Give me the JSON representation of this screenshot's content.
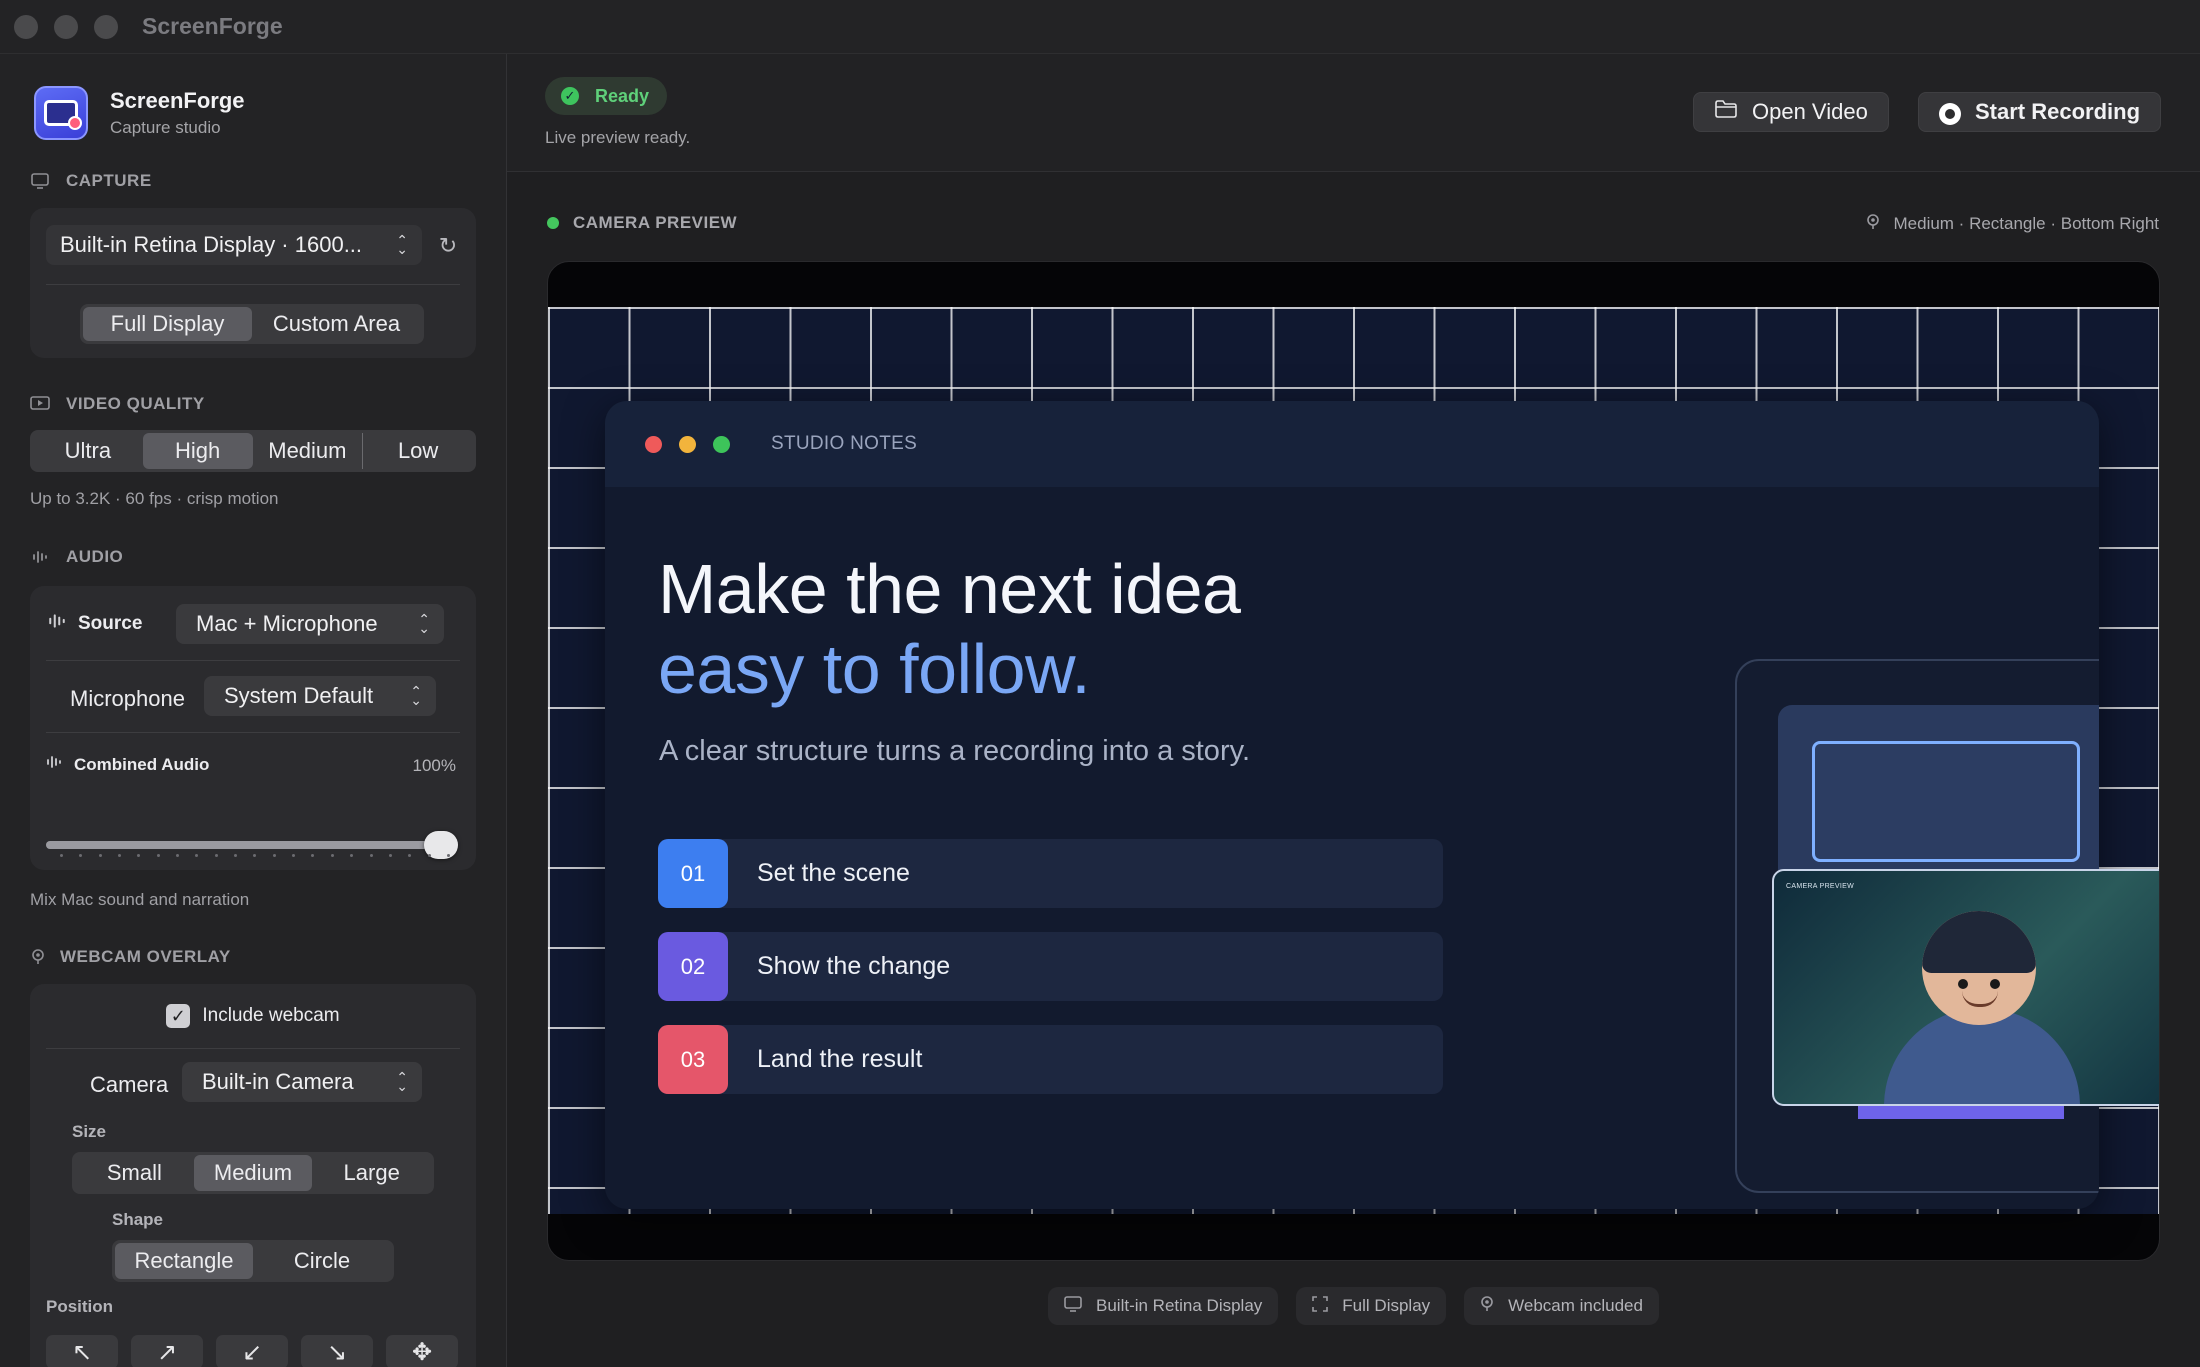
{
  "window": {
    "title": "ScreenForge"
  },
  "app": {
    "name": "ScreenForge",
    "subtitle": "Capture studio"
  },
  "capture": {
    "label": "CAPTURE",
    "display_select": "Built-in Retina Display · 1600...",
    "modes": [
      "Full Display",
      "Custom Area"
    ],
    "selected_mode": "Full Display"
  },
  "video_quality": {
    "label": "VIDEO QUALITY",
    "options": [
      "Ultra",
      "High",
      "Medium",
      "Low"
    ],
    "selected": "High",
    "hint": "Up to 3.2K · 60 fps · crisp motion"
  },
  "audio": {
    "label": "AUDIO",
    "source_label": "Source",
    "source_value": "Mac + Microphone",
    "microphone_label": "Microphone",
    "microphone_value": "System Default",
    "combined_label": "Combined Audio",
    "combined_value": "100%",
    "combined_level": 1.0,
    "hint": "Mix Mac sound and narration"
  },
  "webcam": {
    "label": "WEBCAM OVERLAY",
    "include_label": "Include webcam",
    "include_checked": true,
    "camera_label": "Camera",
    "camera_value": "Built-in Camera",
    "size_label": "Size",
    "sizes": [
      "Small",
      "Medium",
      "Large"
    ],
    "selected_size": "Medium",
    "shape_label": "Shape",
    "shapes": [
      "Rectangle",
      "Circle"
    ],
    "selected_shape": "Rectangle",
    "position_label": "Position",
    "position_icons": [
      "arrow-up-left-icon",
      "arrow-up-right-icon",
      "arrow-down-left-icon",
      "arrow-down-right-icon",
      "move-icon"
    ]
  },
  "status": {
    "pill": "Ready",
    "text": "Live preview ready."
  },
  "toolbar": {
    "open_video": "Open Video",
    "start_recording": "Start Recording"
  },
  "preview": {
    "label": "CAMERA PREVIEW",
    "meta": "Medium · Rectangle · Bottom Right",
    "slide": {
      "window_title": "STUDIO NOTES",
      "headline_1": "Make the next idea",
      "headline_2": "easy to follow.",
      "lead": "A clear structure turns a recording into a story.",
      "steps": [
        {
          "num": "01",
          "label": "Set the scene",
          "color": "#3d7ef0"
        },
        {
          "num": "02",
          "label": "Show the change",
          "color": "#6a5ae0"
        },
        {
          "num": "03",
          "label": "Land the result",
          "color": "#e5566a"
        }
      ]
    },
    "webcam_label": "CAMERA PREVIEW"
  },
  "footer": {
    "chips": [
      {
        "icon": "display-icon",
        "label": "Built-in Retina Display"
      },
      {
        "icon": "fullscreen-icon",
        "label": "Full Display"
      },
      {
        "icon": "webcam-icon",
        "label": "Webcam included"
      }
    ]
  },
  "colors": {
    "accent_green": "#5fd07a",
    "headline_blue": "#7aa7f5"
  }
}
